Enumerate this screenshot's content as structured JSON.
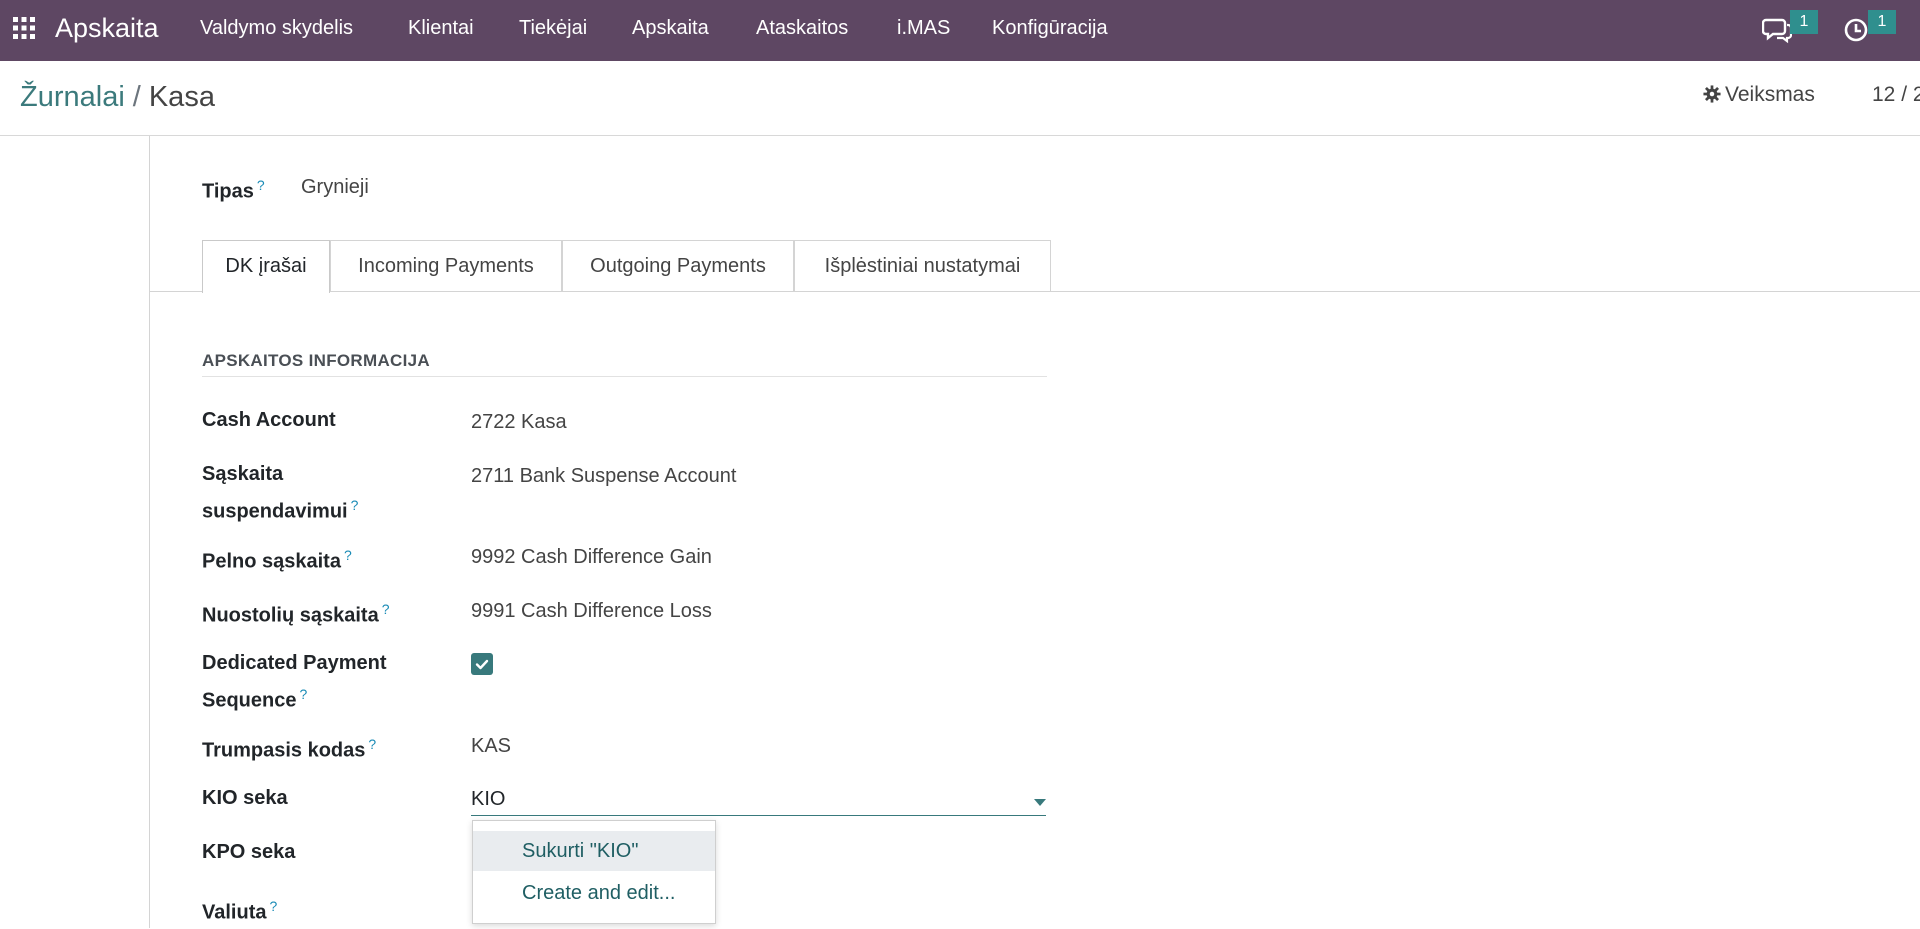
{
  "navbar": {
    "brand": "Apskaita",
    "menu": [
      "Valdymo skydelis",
      "Klientai",
      "Tiekėjai",
      "Apskaita",
      "Ataskaitos",
      "i.MAS",
      "Konfigūracija"
    ],
    "messages_count": "1",
    "activities_count": "1",
    "bg_color": "#5e4763"
  },
  "breadcrumb": {
    "parent": "Žurnalai",
    "separator": "/",
    "current": "Kasa"
  },
  "control": {
    "action_label": "Veiksmas",
    "pager": "12 / 2"
  },
  "form": {
    "type_label": "Tipas",
    "type_help": "?",
    "type_value": "Grynieji",
    "tabs": [
      "DK įrašai",
      "Incoming Payments",
      "Outgoing Payments",
      "Išplėstiniai nustatymai"
    ],
    "section_title": "APSKAITOS INFORMACIJA",
    "fields": {
      "cash_account": {
        "label": "Cash Account",
        "value": "2722 Kasa"
      },
      "suspense_account": {
        "label_line1": "Sąskaita",
        "label_line2": "suspendavimui",
        "value": "2711 Bank Suspense Account"
      },
      "profit_account": {
        "label": "Pelno sąskaita",
        "value": "9992 Cash Difference Gain"
      },
      "loss_account": {
        "label": "Nuostolių sąskaita",
        "value": "9991 Cash Difference Loss"
      },
      "dedicated_seq": {
        "label_line1": "Dedicated Payment",
        "label_line2": "Sequence",
        "checked": true
      },
      "short_code": {
        "label": "Trumpasis kodas",
        "value": "KAS"
      },
      "kio_seq": {
        "label": "KIO seka",
        "value": "KIO"
      },
      "kpo_seq": {
        "label": "KPO seka"
      },
      "currency": {
        "label": "Valiuta"
      }
    },
    "help_mark": "?",
    "dropdown": [
      "Sukurti \"KIO\"",
      "Create and edit..."
    ]
  },
  "colors": {
    "accent": "#38797c",
    "link": "#3b7a7c",
    "badge": "#2f8f8e"
  }
}
